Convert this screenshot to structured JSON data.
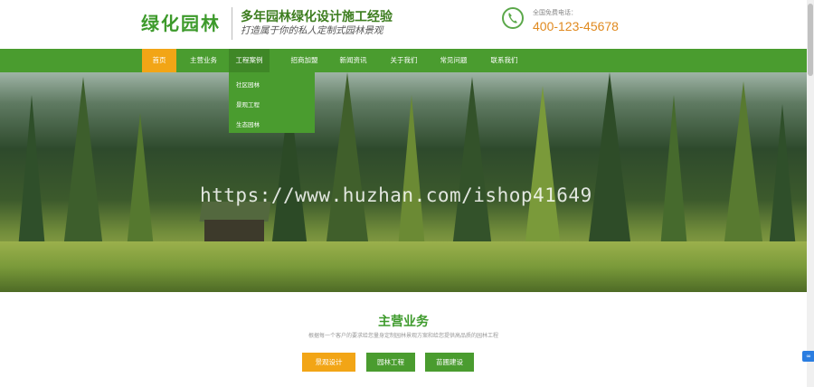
{
  "header": {
    "logo_text": "绿化园林",
    "slogan_main": "多年园林绿化设计施工经验",
    "slogan_sub": "打造属于你的私人定制式园林景观",
    "phone_label": "全国免费电话：",
    "phone_number": "400-123-45678"
  },
  "nav": {
    "items": [
      "首页",
      "主营业务",
      "工程案例",
      "招商加盟",
      "新闻资讯",
      "关于我们",
      "常见问题",
      "联系我们"
    ],
    "active_index": 0,
    "hover_index": 2
  },
  "dropdown": {
    "items": [
      "社区园林",
      "景观工程",
      "生态园林"
    ]
  },
  "banner": {
    "watermark": "https://www.huzhan.com/ishop41649"
  },
  "main_business": {
    "title": "主营业务",
    "description": "根据每一个客户的要求给您量身定制园林景观方案和给您提供高品质的园林工程",
    "tabs": [
      "景观设计",
      "园林工程",
      "苗圃建设"
    ],
    "active_tab": 0
  },
  "colors": {
    "green": "#4a9c2f",
    "orange": "#f2a516",
    "title_green": "#3d9a2b",
    "phone_orange": "#e08a20"
  },
  "icons": {
    "phone": "phone-icon",
    "side": "side-widget-icon"
  }
}
